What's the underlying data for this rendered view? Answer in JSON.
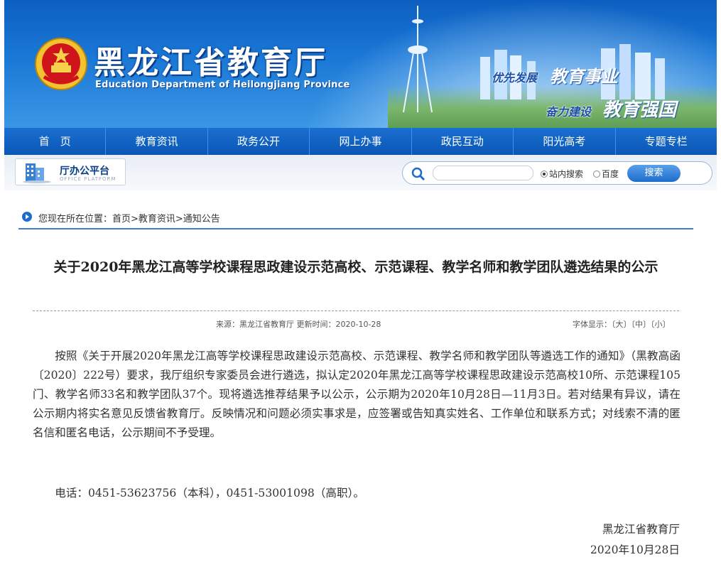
{
  "header": {
    "title_cn": "黑龙江省教育厅",
    "title_en": "Education Department of Heilongjiang Province",
    "slogans": [
      "优先发展",
      "教育事业",
      "奋力建设",
      "教育强国"
    ]
  },
  "nav": {
    "items": [
      "首　页",
      "教育资讯",
      "政务公开",
      "网上办事",
      "政民互动",
      "阳光高考",
      "专题专栏"
    ]
  },
  "toolbar": {
    "office_label": "厅办公平台",
    "office_sub": "OFFICE PLATFORM",
    "search_placeholder": "",
    "radio_site": "站内搜索",
    "radio_baidu": "百度",
    "search_button": "搜索"
  },
  "breadcrumb": {
    "text": "您现在所在位置：首页>教育资讯>通知公告"
  },
  "article": {
    "title": "关于2020年黑龙江高等学校课程思政建设示范高校、示范课程、教学名师和教学团队遴选结果的公示",
    "meta": "来源：黑龙江省教育厅 更新时间：2020-10-28",
    "font_label": "字体显示：",
    "font_large": "〔大〕",
    "font_medium": "〔中〕",
    "font_small": "〔小〕",
    "body": "按照《关于开展2020年黑龙江高等学校课程思政建设示范高校、示范课程、教学名师和教学团队等遴选工作的通知》（黑教高函〔2020〕222号）要求，我厅组织专家委员会进行遴选，拟认定2020年黑龙江高等学校课程思政建设示范高校10所、示范课程105门、教学名师33名和教学团队37个。现将遴选推荐结果予以公示，公示期为2020年10月28日—11月3日。若对结果有异议，请在公示期内将实名意见反馈省教育厅。反映情况和问题必须实事求是，应签署或告知真实姓名、工作单位和联系方式；对线索不清的匿名信和匿名电话，公示期间不予受理。",
    "phone": "电话：0451-53623756（本科），0451-53001098（高职）。",
    "sign_org": "黑龙江省教育厅",
    "sign_date": "2020年10月28日"
  },
  "colors": {
    "banner_blue": "#0c5fc0",
    "nav_blue": "#0a56b5",
    "accent_line": "#3b7fc7"
  }
}
